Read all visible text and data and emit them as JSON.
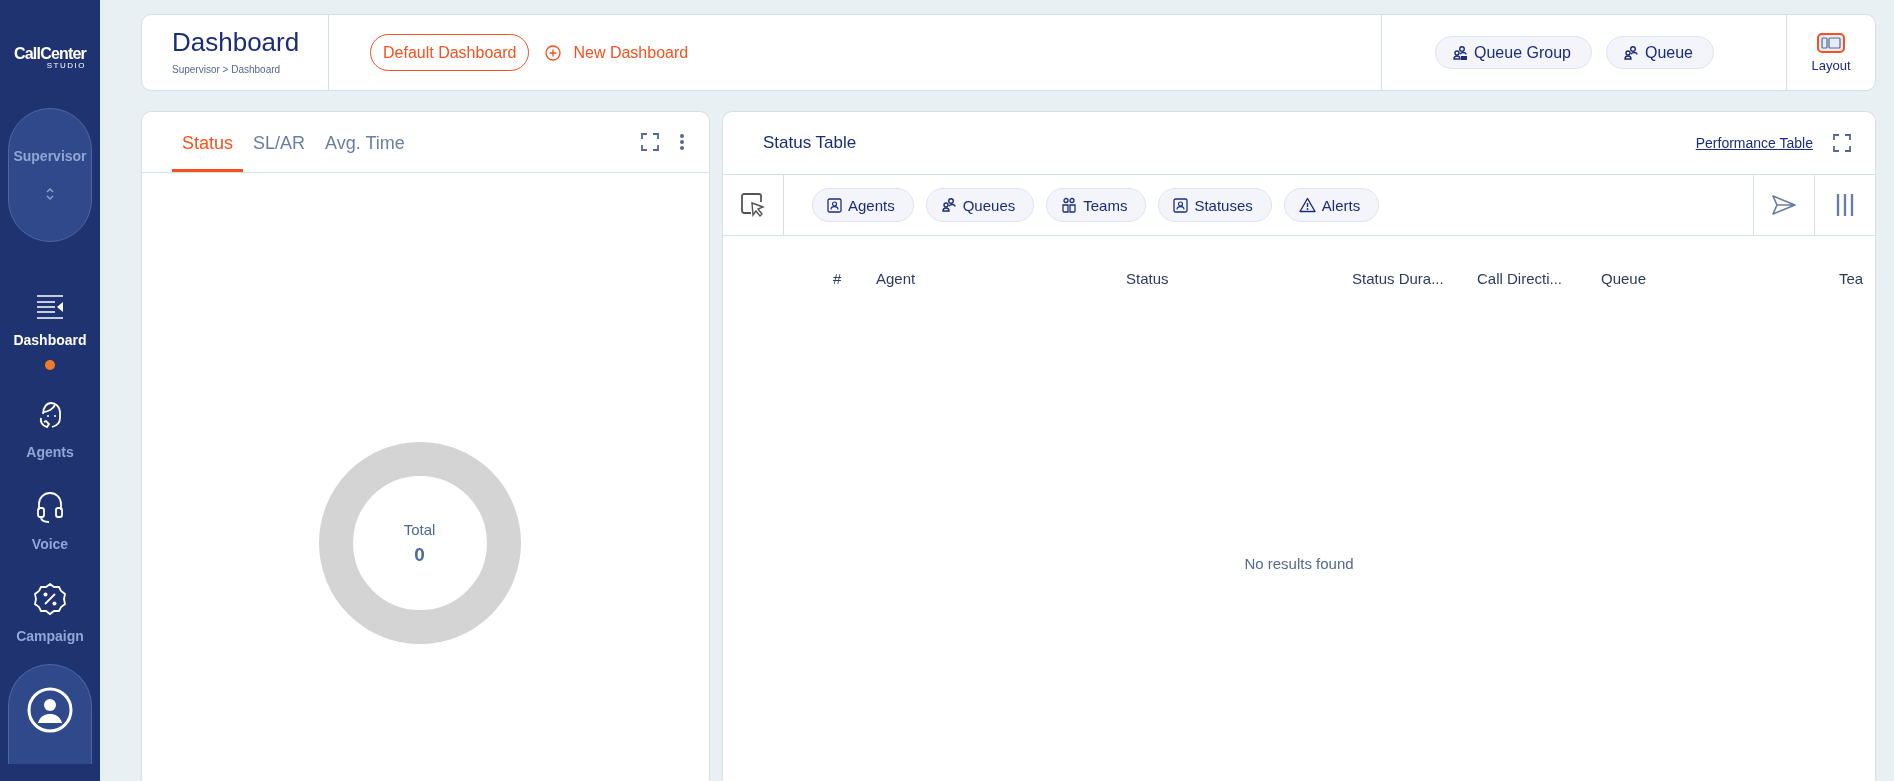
{
  "sidebar": {
    "logo": "CallCenter",
    "logo_sub": "STUDIO",
    "role": "Supervisor",
    "items": [
      {
        "label": "Dashboard",
        "selected": true
      },
      {
        "label": "Agents",
        "selected": false
      },
      {
        "label": "Voice",
        "selected": false
      },
      {
        "label": "Campaign",
        "selected": false
      }
    ]
  },
  "header": {
    "title": "Dashboard",
    "breadcrumb": "Supervisor > Dashboard",
    "default_dashboard": "Default Dashboard",
    "new_dashboard": "New Dashboard",
    "filters": [
      "Queue Group",
      "Queue"
    ],
    "layout": "Layout"
  },
  "left_panel": {
    "tabs": [
      {
        "label": "Status",
        "selected": true
      },
      {
        "label": "SL/AR",
        "selected": false
      },
      {
        "label": "Avg. Time",
        "selected": false
      }
    ],
    "donut": {
      "label": "Total",
      "value": "0"
    }
  },
  "right_panel": {
    "title": "Status Table",
    "link": "Performance Table",
    "chips": [
      "Agents",
      "Queues",
      "Teams",
      "Statuses",
      "Alerts"
    ],
    "columns": [
      "#",
      "Agent",
      "Status",
      "Status Dura...",
      "Call Directi...",
      "Queue",
      "Tea"
    ],
    "empty": "No results found"
  }
}
